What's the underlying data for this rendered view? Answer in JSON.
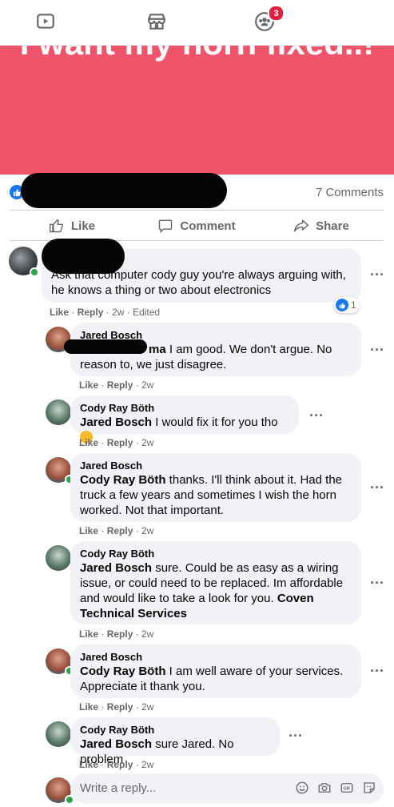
{
  "nav": {
    "watch_icon": "video-icon",
    "marketplace_icon": "store-icon",
    "groups_icon": "groups-icon",
    "groups_badge": "3"
  },
  "banner": {
    "text": "I want my horn fixed..!",
    "color": "#f0546b"
  },
  "post": {
    "comments_count": "7 Comments"
  },
  "actions": {
    "like": "Like",
    "comment": "Comment",
    "share": "Share"
  },
  "comments": [
    {
      "name": "",
      "text": "Ask that computer cody guy you're always arguing with, he knows a thing or two about electronics",
      "like": "Like",
      "reply": "Reply",
      "time": "2w",
      "edited": "Edited",
      "reaction_count": "1"
    },
    {
      "name": "Jared Bosch",
      "tag": "",
      "tag_visible": "ma",
      "text": " I am good. We don't argue. No reason to, we just disagree.",
      "like": "Like",
      "reply": "Reply",
      "time": "2w"
    },
    {
      "name": "Cody Ray Böth",
      "tag": "Jared Bosch",
      "text": " I would fix it for you tho",
      "like": "Like",
      "reply": "Reply",
      "time": "2w"
    },
    {
      "name": "Jared Bosch",
      "tag": "Cody Ray Böth",
      "text": " thanks. I'll think about it. Had the truck a few years and sometimes I wish the horn worked. Not that important.",
      "like": "Like",
      "reply": "Reply",
      "time": "2w"
    },
    {
      "name": "Cody Ray Böth",
      "tag": "Jared Bosch",
      "text": " sure. Could be as easy as a wiring issue, or could need to be replaced. Im affordable and would like to take a look for you. ",
      "link": "Coven Technical Services",
      "like": "Like",
      "reply": "Reply",
      "time": "2w"
    },
    {
      "name": "Jared Bosch",
      "tag": "Cody Ray Böth",
      "text": " I am well aware of your services. Appreciate it thank you.",
      "like": "Like",
      "reply": "Reply",
      "time": "2w"
    },
    {
      "name": "Cody Ray Böth",
      "tag": "Jared Bosch",
      "text": " sure Jared. No problem",
      "like": "Like",
      "reply": "Reply",
      "time": "2w"
    }
  ],
  "reply_box": {
    "placeholder": "Write a reply..."
  }
}
